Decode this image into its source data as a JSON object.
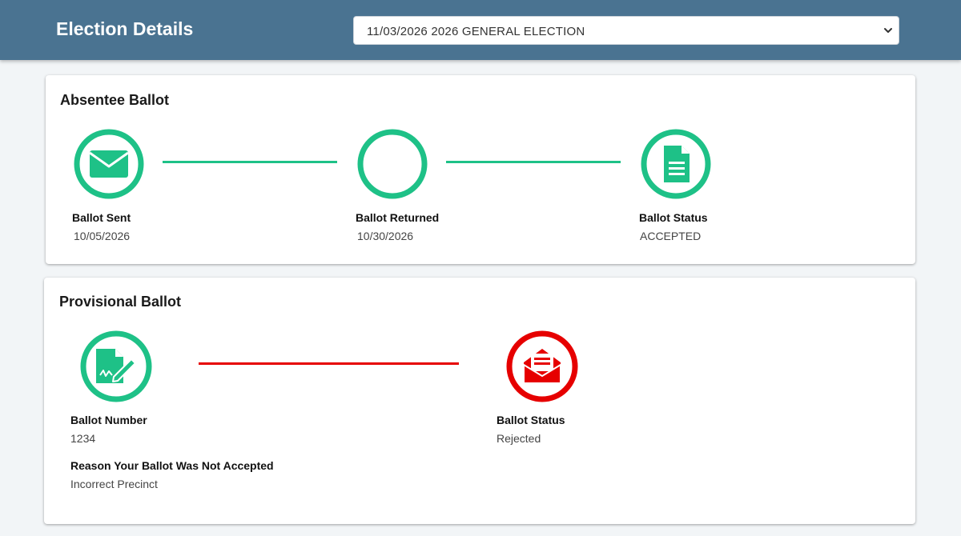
{
  "header": {
    "title": "Election Details",
    "election_select": {
      "selected": "11/03/2026 2026 GENERAL ELECTION"
    }
  },
  "colors": {
    "header_bg": "#4a7391",
    "success": "#1ec187",
    "error": "#e60000"
  },
  "absentee": {
    "title": "Absentee Ballot",
    "steps": [
      {
        "icon": "envelope-icon",
        "label": "Ballot Sent",
        "value": "10/05/2026",
        "status": "complete"
      },
      {
        "icon": "empty-circle-icon",
        "label": "Ballot Returned",
        "value": "10/30/2026",
        "status": "complete"
      },
      {
        "icon": "document-icon",
        "label": "Ballot Status",
        "value": "ACCEPTED",
        "status": "complete"
      }
    ]
  },
  "provisional": {
    "title": "Provisional Ballot",
    "ballot_number": {
      "icon": "signed-document-icon",
      "label": "Ballot Number",
      "value": "1234"
    },
    "reason": {
      "label": "Reason Your Ballot Was Not Accepted",
      "value": "Incorrect Precinct"
    },
    "status": {
      "icon": "open-envelope-icon",
      "label": "Ballot Status",
      "value": "Rejected"
    }
  }
}
